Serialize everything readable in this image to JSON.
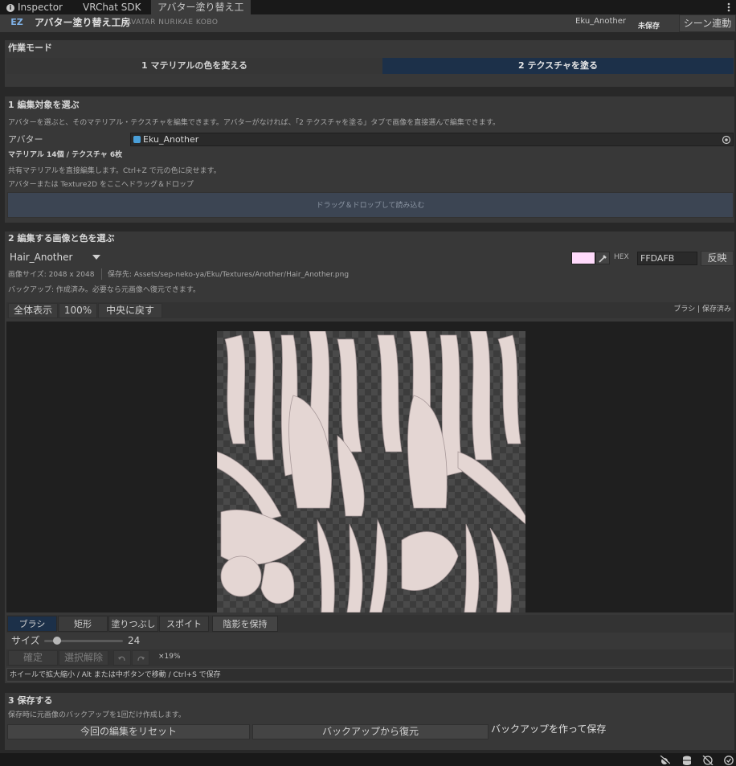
{
  "tabs": [
    {
      "label": "Inspector",
      "icon": "info-icon"
    },
    {
      "label": "VRChat SDK"
    },
    {
      "label": "アバター塗り替え工房"
    }
  ],
  "header": {
    "logo": "EZ",
    "title": "アバター塗り替え工房",
    "subtitle": "AVATAR NURIKAE KOBO",
    "avatar_name": "Eku_Another",
    "save_status": "未保存",
    "scene_link_button": "シーン連動"
  },
  "mode": {
    "title": "作業モード",
    "tab1": "1  マテリアルの色を変える",
    "tab2": "2  テクスチャを塗る",
    "active_tab": 2
  },
  "section1": {
    "title": "1  編集対象を選ぶ",
    "desc": "アバターを選ぶと、そのマテリアル・テクスチャを編集できます。アバターがなければ、「2 テクスチャを塗る」タブで画像を直接選んで編集できます。",
    "avatar_label": "アバター",
    "avatar_value": "Eku_Another",
    "counts": "マテリアル 14個 / テクスチャ 6枚",
    "shared_note": "共有マテリアルを直接編集します。Ctrl+Z で元の色に戻せます。",
    "drop_note": "アバターまたは Texture2D をここへドラッグ＆ドロップ",
    "drop_area": "ドラッグ＆ドロップして読み込む"
  },
  "section2": {
    "title": "2  編集する画像と色を選ぶ",
    "texture_select": "Hair_Another",
    "hex_label": "HEX",
    "hex_value": "FFDAFB",
    "apply_button": "反映",
    "swatch_color": "#FFDAFB",
    "image_size": "画像サイズ: 2048 x 2048",
    "save_path": "保存先: Assets/sep-neko-ya/Eku/Textures/Another/Hair_Another.png",
    "backup_note": "バックアップ: 作成済み。必要なら元画像へ復元できます。"
  },
  "canvas_toolbar": {
    "fit": "全体表示",
    "zoom100": "100%",
    "center": "中央に戻す",
    "status": "ブラシ | 保存済み"
  },
  "tools": {
    "brush": "ブラシ",
    "rect": "矩形",
    "fill": "塗りつぶし",
    "eyedropper": "スポイト",
    "keep_shading": "陰影を保持",
    "active": "brush"
  },
  "size": {
    "label": "サイズ",
    "value": "24",
    "level": 0.24
  },
  "actions": {
    "confirm": "確定",
    "deselect": "選択解除",
    "zoom_readout": "×19%"
  },
  "hint": "ホイールで拡大縮小 / Alt または中ボタンで移動 / Ctrl+S で保存",
  "section3": {
    "title": "3  保存する",
    "desc": "保存時に元画像のバックアップを1回だけ作成します。",
    "reset_button": "今回の編集をリセット",
    "restore_button": "バックアップから復元",
    "backup_save_button": "バックアップを作って保存"
  },
  "colors": {
    "accent": "#1c3049",
    "panel": "#383838",
    "background": "#282828",
    "canvas": "#1f1f1f"
  }
}
